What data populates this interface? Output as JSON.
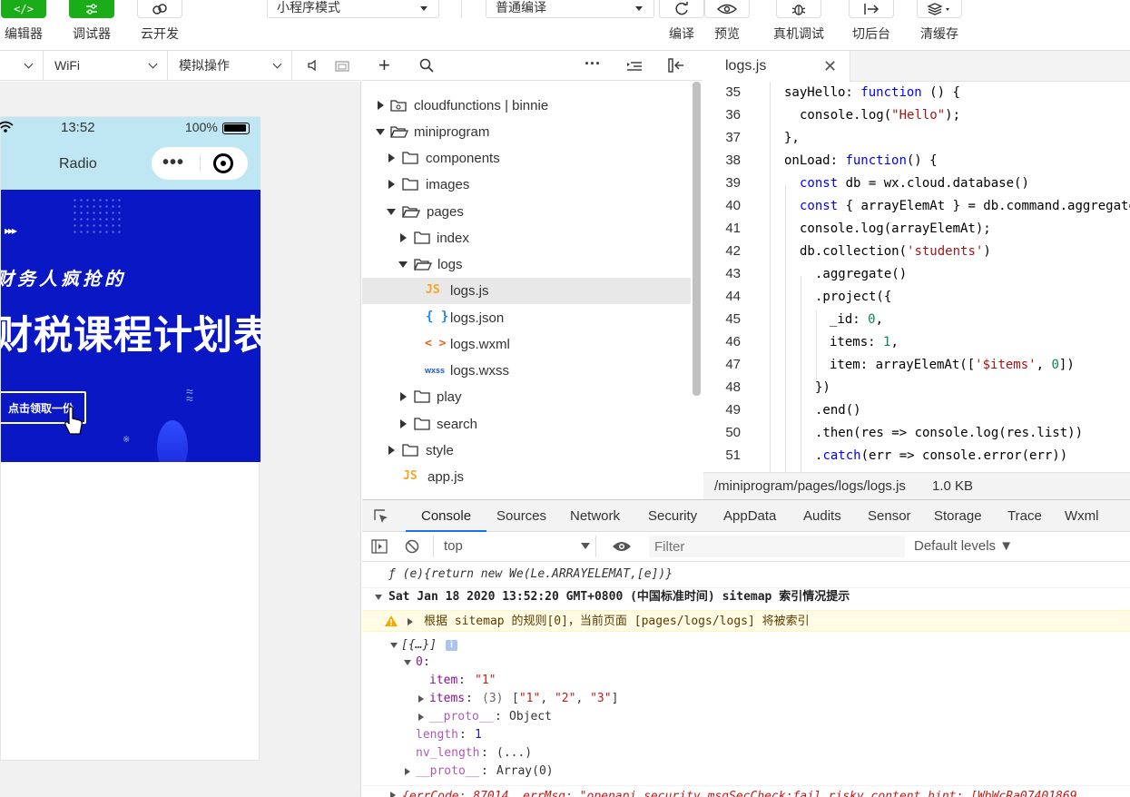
{
  "toolbar": {
    "editor_label": "编辑器",
    "debugger_label": "调试器",
    "cloud_label": "云开发",
    "mode_select": "小程序模式",
    "compile_select": "普通编译",
    "compile_label": "编译",
    "preview_label": "预览",
    "remote_debug_label": "真机调试",
    "background_label": "切后台",
    "clear_cache_label": "清缓存",
    "accent_color": "#1aad19"
  },
  "simulator": {
    "network_select": "WiFi",
    "operation_select": "模拟操作",
    "status_time": "13:52",
    "battery": "100%",
    "nav_title": "Radio",
    "banner": {
      "subtitle": "财务人疯抢的",
      "title": "财税课程计划表",
      "cta": "点击领取一份",
      "background_color": "#0a17c4"
    }
  },
  "tree": {
    "items": [
      {
        "label": "cloudfunctions | binnie",
        "type": "folder-cloud"
      },
      {
        "label": "miniprogram",
        "type": "folder-open"
      },
      {
        "label": "components",
        "type": "folder"
      },
      {
        "label": "images",
        "type": "folder"
      },
      {
        "label": "pages",
        "type": "folder-open"
      },
      {
        "label": "index",
        "type": "folder"
      },
      {
        "label": "logs",
        "type": "folder-open"
      },
      {
        "label": "logs.js",
        "type": "js"
      },
      {
        "label": "logs.json",
        "type": "json"
      },
      {
        "label": "logs.wxml",
        "type": "wxml"
      },
      {
        "label": "logs.wxss",
        "type": "wxss"
      },
      {
        "label": "play",
        "type": "folder"
      },
      {
        "label": "search",
        "type": "folder"
      },
      {
        "label": "style",
        "type": "folder"
      },
      {
        "label": "app.js",
        "type": "js"
      }
    ],
    "icon_js": "JS",
    "icon_json": "{ }",
    "icon_wxml": "< >",
    "icon_wxss": "wxss"
  },
  "editor": {
    "tab_label": "logs.js",
    "line_numbers": [
      "35",
      "36",
      "37",
      "38",
      "39",
      "40",
      "41",
      "42",
      "43",
      "44",
      "45",
      "46",
      "47",
      "48",
      "49",
      "50",
      "51"
    ],
    "file_path": "/miniprogram/pages/logs/logs.js",
    "file_size": "1.0 KB",
    "code": {
      "l35": [
        "sayHello: ",
        "function",
        " () {"
      ],
      "l36": [
        "console.log(",
        "\"Hello\"",
        ");"
      ],
      "l37": "},",
      "l38": [
        "onLoad: ",
        "function",
        "() {"
      ],
      "l39": [
        "const",
        " db = wx.cloud.database()"
      ],
      "l40": [
        "const",
        " { arrayElemAt } = db.command.aggregate"
      ],
      "l41": "console.log(arrayElemAt);",
      "l42": [
        "db.collection(",
        "'students'",
        ")"
      ],
      "l43": ".aggregate()",
      "l44": ".project({",
      "l45": [
        "_id: ",
        "0",
        ","
      ],
      "l46": [
        "items: ",
        "1",
        ","
      ],
      "l47": [
        "item: arrayElemAt([",
        "'$items'",
        ", ",
        "0",
        "])"
      ],
      "l48": "})",
      "l49": ".end()",
      "l50": ".then(res => console.log(res.list))",
      "l51": [
        ".",
        "catch",
        "(err => console.error(err))"
      ]
    }
  },
  "devtools": {
    "tabs": [
      "Console",
      "Sources",
      "Network",
      "Security",
      "AppData",
      "Audits",
      "Sensor",
      "Storage",
      "Trace",
      "Wxml"
    ],
    "context_select": "top",
    "filter_placeholder": "Filter",
    "levels_select": "Default levels ▼",
    "lines": {
      "fn": "ƒ (e){return new We(Le.ARRAYELEMAT,[e])}",
      "group_date": "Sat Jan 18 2020 13:52:20 GMT+0800 (中国标准时间) sitemap 索引情况提示",
      "warning": "根据 sitemap 的规则[0]，当前页面 [pages/logs/logs] 将被索引",
      "array_summary": "[{…}]",
      "index0": "0",
      "item_key": "item",
      "item_val": "\"1\"",
      "items_key": "items",
      "items_count": "(3)",
      "items_val": "[\"1\", \"2\", \"3\"]",
      "proto_key": "__proto__",
      "proto_obj": "Object",
      "length_key": "length",
      "length_val": "1",
      "nv_key": "nv_length",
      "nv_val": "(...)",
      "proto_arr": "Array(0)",
      "error_line": "{errCode: 87014, errMsg: \"openapi.security.msgSecCheck:fail risky content hint: [WbWcRa07401869"
    }
  }
}
